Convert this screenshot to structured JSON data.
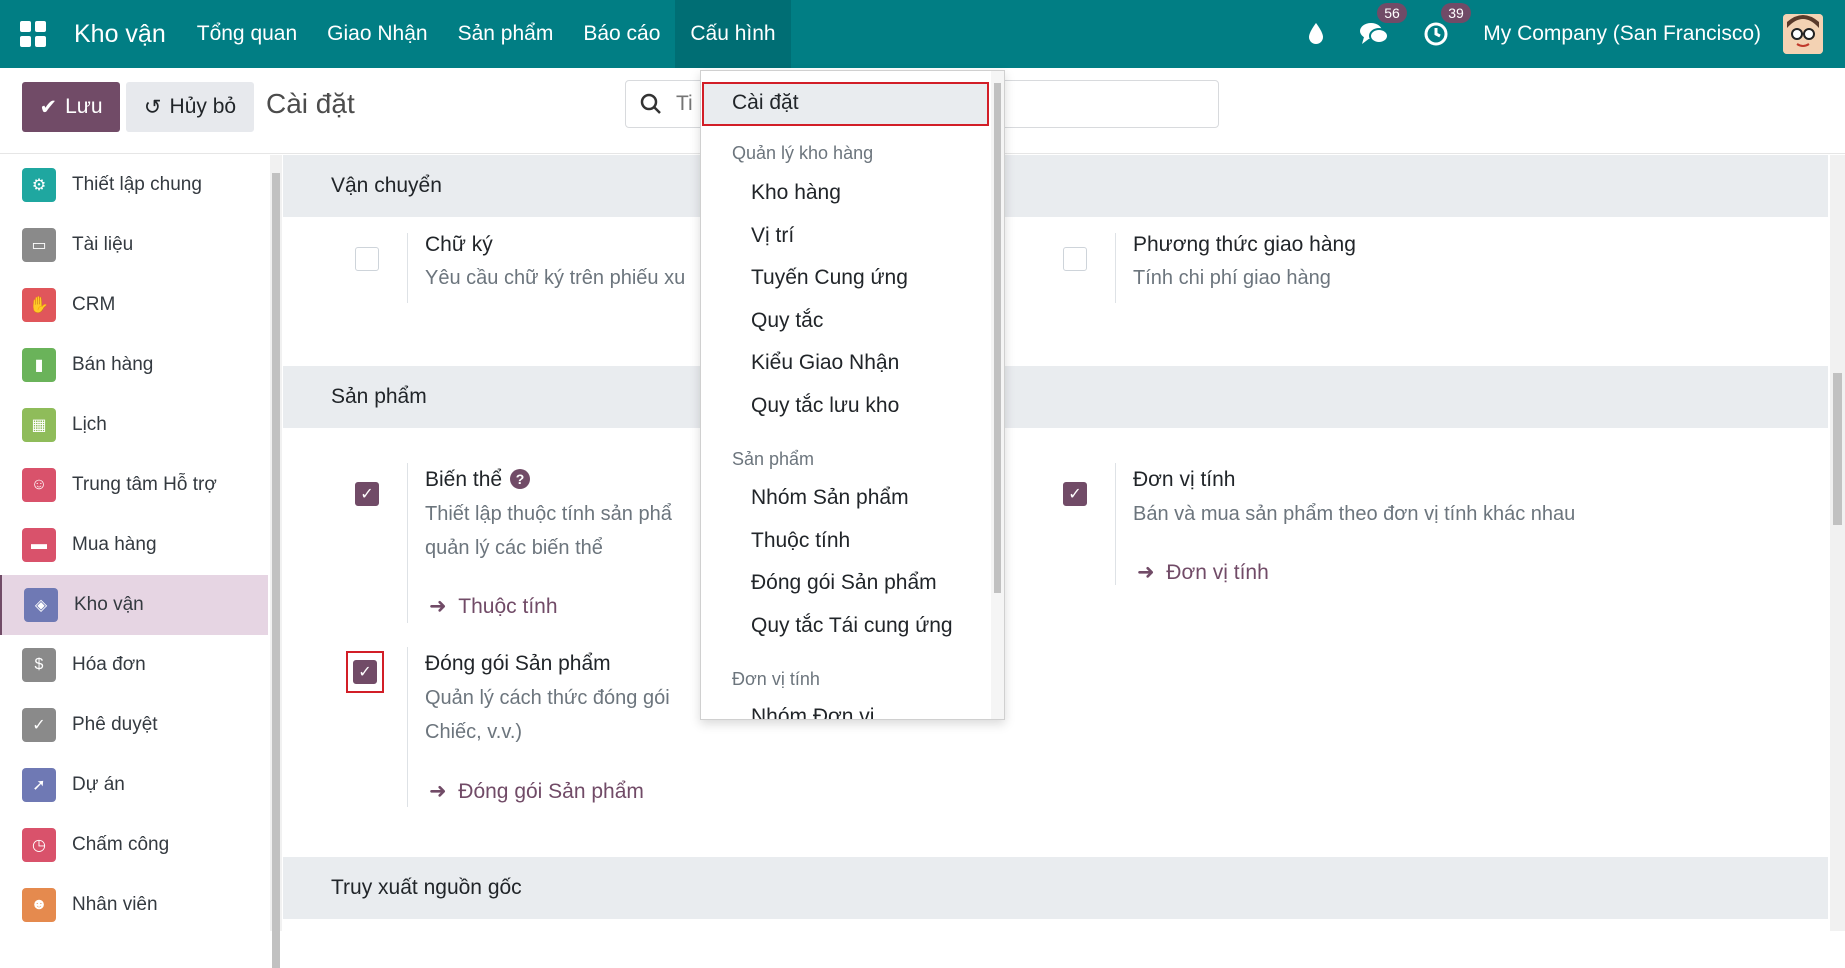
{
  "navbar": {
    "brand": "Kho vận",
    "menu": [
      "Tổng quan",
      "Giao Nhận",
      "Sản phẩm",
      "Báo cáo",
      "Cấu hình"
    ],
    "messages_count": "56",
    "activities_count": "39",
    "company": "My Company (San Francisco)"
  },
  "control": {
    "save_label": "Lưu",
    "cancel_label": "Hủy bỏ",
    "page_title": "Cài đặt",
    "search_placeholder": "Ti"
  },
  "sidebar": {
    "items": [
      {
        "label": "Thiết lập chung",
        "color": "#1fa7a0"
      },
      {
        "label": "Tài liệu",
        "color": "#8a8a8a"
      },
      {
        "label": "CRM",
        "color": "#e0565b"
      },
      {
        "label": "Bán hàng",
        "color": "#6ab35a"
      },
      {
        "label": "Lịch",
        "color": "#8fbc5a"
      },
      {
        "label": "Trung tâm Hỗ trợ",
        "color": "#d9526b"
      },
      {
        "label": "Mua hàng",
        "color": "#d9526b"
      },
      {
        "label": "Kho vận",
        "color": "#6f79b4"
      },
      {
        "label": "Hóa đơn",
        "color": "#8a8a8a"
      },
      {
        "label": "Phê duyệt",
        "color": "#8a8a8a"
      },
      {
        "label": "Dự án",
        "color": "#6f79b4"
      },
      {
        "label": "Chấm công",
        "color": "#d9526b"
      },
      {
        "label": "Nhân viên",
        "color": "#e58a4e"
      }
    ]
  },
  "sections": {
    "shipping": {
      "title": "Vận chuyển",
      "signature_title": "Chữ ký",
      "signature_desc": "Yêu cầu chữ ký trên phiếu xu",
      "delivery_title": "Phương thức giao hàng",
      "delivery_desc": "Tính chi phí giao hàng"
    },
    "products": {
      "title": "Sản phẩm",
      "variants_title": "Biến thể",
      "variants_desc_1": "Thiết lập thuộc tính sản phẩ",
      "variants_desc_2": "quản lý các biến thể",
      "variants_link": "Thuộc tính",
      "uom_title": "Đơn vị tính",
      "uom_desc": "Bán và mua sản phẩm theo đơn vị tính khác nhau",
      "uom_link": "Đơn vị tính",
      "packaging_title": "Đóng gói Sản phẩm",
      "packaging_desc_1": "Quản lý cách thức đóng gói",
      "packaging_desc_2": "Chiếc, v.v.)",
      "packaging_link": "Đóng gói Sản phẩm"
    },
    "traceability": {
      "title": "Truy xuất nguồn gốc"
    }
  },
  "dropdown": {
    "top_item": "Cài đặt",
    "groups": [
      {
        "header": "Quản lý kho hàng",
        "items": [
          "Kho hàng",
          "Vị trí",
          "Tuyến Cung ứng",
          "Quy tắc",
          "Kiểu Giao Nhận",
          "Quy tắc lưu kho"
        ]
      },
      {
        "header": "Sản phẩm",
        "items": [
          "Nhóm Sản phẩm",
          "Thuộc tính",
          "Đóng gói Sản phẩm",
          "Quy tắc Tái cung ứng"
        ]
      },
      {
        "header": "Đơn vị tính",
        "items": [
          "Nhóm Đơn vị"
        ]
      }
    ]
  },
  "colors": {
    "navbar": "#017e84",
    "primary": "#714b67",
    "highlight": "#d21e27"
  }
}
